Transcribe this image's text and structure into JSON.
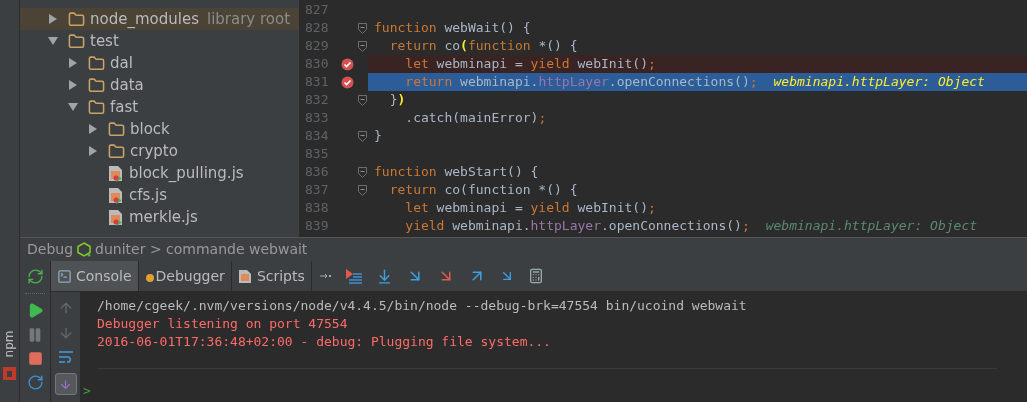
{
  "project_tree": [
    {
      "label": "node_modules",
      "note": "library root",
      "kind": "folder",
      "expanded": false,
      "library": true
    },
    {
      "label": "test",
      "kind": "folder",
      "expanded": true,
      "children": [
        {
          "label": "dal",
          "kind": "folder",
          "expanded": false
        },
        {
          "label": "data",
          "kind": "folder",
          "expanded": false
        },
        {
          "label": "fast",
          "kind": "folder",
          "expanded": true,
          "children": [
            {
              "label": "block",
              "kind": "folder",
              "expanded": false
            },
            {
              "label": "crypto",
              "kind": "folder",
              "expanded": false
            },
            {
              "label": "block_pulling.js",
              "kind": "test_file"
            },
            {
              "label": "cfs.js",
              "kind": "test_file"
            },
            {
              "label": "merkle.js",
              "kind": "test_file"
            }
          ]
        }
      ]
    }
  ],
  "editor": {
    "lines": [
      {
        "number": "827",
        "breakpoint": false,
        "current": false,
        "fold": false
      },
      {
        "number": "828",
        "breakpoint": false,
        "current": false,
        "fold": true,
        "tokens": [
          {
            "kind": "keyword",
            "text": "function"
          },
          {
            "kind": "plain",
            "text": " webWait() {"
          }
        ]
      },
      {
        "number": "829",
        "breakpoint": false,
        "current": false,
        "fold": true,
        "tokens": [
          {
            "kind": "keyword",
            "text": "  return"
          },
          {
            "kind": "plain",
            "text": " co"
          },
          {
            "kind": "brace",
            "text": "("
          },
          {
            "kind": "keyword",
            "text": "function"
          },
          {
            "kind": "plain",
            "text": " *() {"
          }
        ]
      },
      {
        "number": "830",
        "breakpoint": true,
        "current": false,
        "fold": false,
        "tokens": [
          {
            "kind": "keyword",
            "text": "    let"
          },
          {
            "kind": "plain",
            "text": " webminapi = "
          },
          {
            "kind": "keyword",
            "text": "yield"
          },
          {
            "kind": "plain",
            "text": " webInit()"
          },
          {
            "kind": "keyword",
            "text": ";"
          }
        ]
      },
      {
        "number": "831",
        "breakpoint": true,
        "current": true,
        "fold": false,
        "tokens": [
          {
            "kind": "keyword",
            "text": "    return"
          },
          {
            "kind": "plain",
            "text": " webminapi."
          },
          {
            "kind": "field",
            "text": "httpLayer"
          },
          {
            "kind": "plain",
            "text": ".openConnections()"
          },
          {
            "kind": "keyword",
            "text": ";"
          },
          {
            "kind": "hint",
            "text": "webminapi.httpLayer: Object"
          }
        ]
      },
      {
        "number": "832",
        "breakpoint": false,
        "current": false,
        "fold": true,
        "tokens": [
          {
            "kind": "plain",
            "text": "  }"
          },
          {
            "kind": "brace",
            "text": ")"
          }
        ]
      },
      {
        "number": "833",
        "breakpoint": false,
        "current": false,
        "fold": false,
        "tokens": [
          {
            "kind": "plain",
            "text": "    .catch(mainError)"
          },
          {
            "kind": "keyword",
            "text": ";"
          }
        ]
      },
      {
        "number": "834",
        "breakpoint": false,
        "current": false,
        "fold": true,
        "tokens": [
          {
            "kind": "plain",
            "text": "}"
          }
        ]
      },
      {
        "number": "835",
        "breakpoint": false,
        "current": false,
        "fold": false
      },
      {
        "number": "836",
        "breakpoint": false,
        "current": false,
        "fold": true,
        "tokens": [
          {
            "kind": "keyword",
            "text": "function"
          },
          {
            "kind": "plain",
            "text": " webStart() {"
          }
        ]
      },
      {
        "number": "837",
        "breakpoint": false,
        "current": false,
        "fold": true,
        "tokens": [
          {
            "kind": "keyword",
            "text": "  return"
          },
          {
            "kind": "plain",
            "text": " co(function *() {"
          }
        ]
      },
      {
        "number": "838",
        "breakpoint": false,
        "current": false,
        "fold": false,
        "tokens": [
          {
            "kind": "keyword",
            "text": "    let"
          },
          {
            "kind": "plain",
            "text": " webminapi = "
          },
          {
            "kind": "keyword",
            "text": "yield"
          },
          {
            "kind": "plain",
            "text": " webInit()"
          },
          {
            "kind": "keyword",
            "text": ";"
          }
        ]
      },
      {
        "number": "839",
        "breakpoint": false,
        "current": false,
        "fold": false,
        "tokens": [
          {
            "kind": "keyword",
            "text": "    yield"
          },
          {
            "kind": "plain",
            "text": " webminapi."
          },
          {
            "kind": "field",
            "text": "httpLayer"
          },
          {
            "kind": "plain",
            "text": ".openConnections()"
          },
          {
            "kind": "keyword",
            "text": ";"
          },
          {
            "kind": "hint",
            "text": "webminapi.httpLayer: Object"
          }
        ]
      }
    ]
  },
  "debug_panel": {
    "title": "Debug",
    "configuration": "duniter > commande webwait",
    "tabs": [
      {
        "label": "Console",
        "selected": true
      },
      {
        "label": "Debugger",
        "selected": false
      },
      {
        "label": "Scripts",
        "selected": false
      }
    ],
    "console_lines": [
      {
        "kind": "command",
        "text": "/home/cgeek/.nvm/versions/node/v4.4.5/bin/node --debug-brk=47554 bin/ucoind webwait"
      },
      {
        "kind": "error",
        "text": "Debugger listening on port 47554"
      },
      {
        "kind": "error",
        "text": "2016-06-01T17:36:48+02:00 - debug: Plugging file system..."
      }
    ],
    "prompt": ">"
  },
  "side_tab": {
    "label": "npm"
  }
}
